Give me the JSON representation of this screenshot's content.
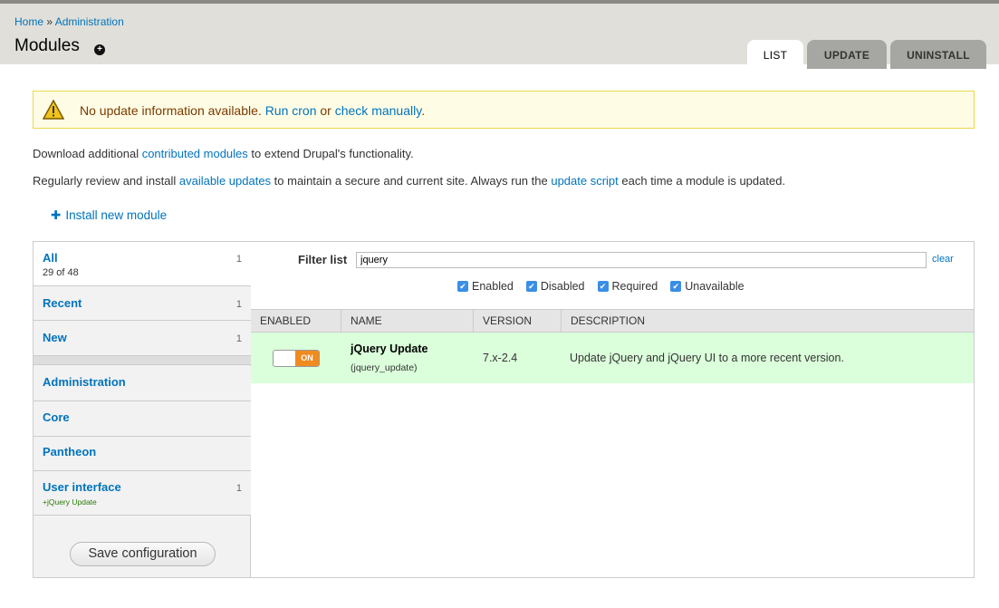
{
  "breadcrumb": {
    "home": "Home",
    "separator": "»",
    "admin": "Administration"
  },
  "page": {
    "title": "Modules",
    "shortcut_icon": "plus-circle-icon"
  },
  "tabs": [
    {
      "label": "List",
      "active": true
    },
    {
      "label": "Update",
      "active": false
    },
    {
      "label": "Uninstall",
      "active": false
    }
  ],
  "message": {
    "icon": "warning-triangle-icon",
    "text": "No update information available.",
    "run_cron": "Run cron",
    "or": "or",
    "check_manually": "check manually",
    "period": "."
  },
  "intro": {
    "p1_pre": "Download additional ",
    "p1_link": "contributed modules",
    "p1_post": " to extend Drupal's functionality.",
    "p2_pre": "Regularly review and install ",
    "p2_link1": "available updates",
    "p2_mid": " to maintain a secure and current site. Always run the ",
    "p2_link2": "update script",
    "p2_post": " each time a module is updated."
  },
  "install_link": {
    "icon": "plus-icon",
    "label": "Install new module"
  },
  "sidebar": {
    "items": [
      {
        "label": "All",
        "count": "1",
        "sub": "29 of 48"
      },
      {
        "label": "Recent",
        "count": "1"
      },
      {
        "label": "New",
        "count": "1"
      },
      {
        "label": "Administration"
      },
      {
        "label": "Core"
      },
      {
        "label": "Pantheon"
      },
      {
        "label": "User interface",
        "count": "1",
        "sub": "+jQuery Update"
      }
    ],
    "save_label": "Save configuration"
  },
  "filter": {
    "label": "Filter list",
    "value": "jquery",
    "clear": "clear",
    "checks": [
      {
        "label": "Enabled",
        "checked": true
      },
      {
        "label": "Disabled",
        "checked": true
      },
      {
        "label": "Required",
        "checked": true
      },
      {
        "label": "Unavailable",
        "checked": true
      }
    ]
  },
  "table": {
    "headers": [
      "Enabled",
      "Name",
      "Version",
      "Description"
    ],
    "rows": [
      {
        "toggle": "ON",
        "name": "jQuery Update",
        "machine": "(jquery_update)",
        "version": "7.x-2.4",
        "description": "Update jQuery and jQuery UI to a more recent version."
      }
    ]
  },
  "colors": {
    "link": "#0074bd",
    "row_enabled_bg": "#dbffdb",
    "toggle_on": "#ef8b1f",
    "warning_bg": "#fffce5"
  }
}
